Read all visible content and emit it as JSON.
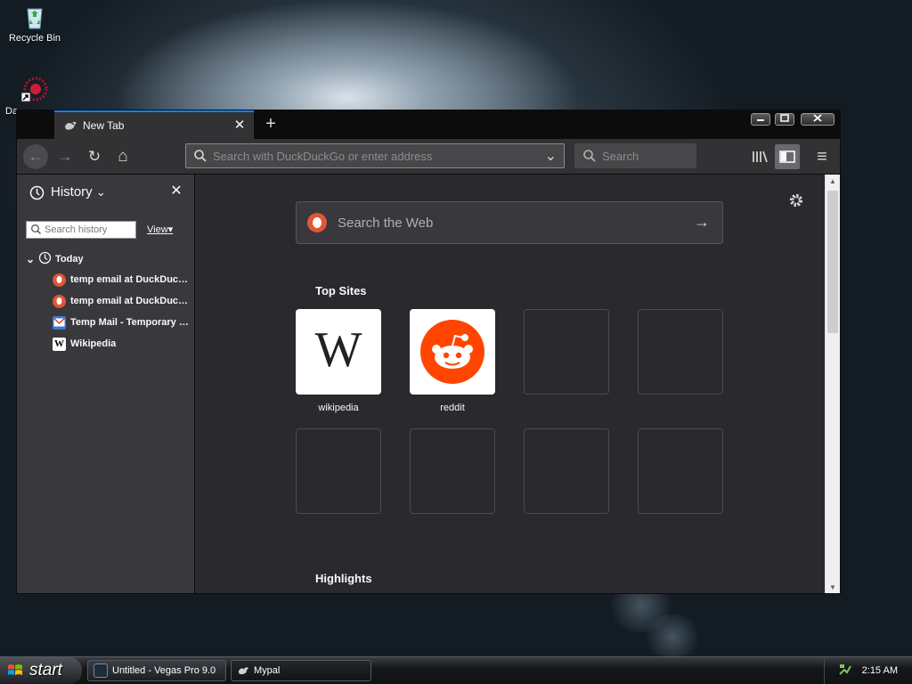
{
  "desktop": {
    "icons": [
      {
        "label": "Recycle Bin"
      },
      {
        "label": "Da"
      }
    ]
  },
  "browser": {
    "tab": {
      "title": "New Tab",
      "close": "✕"
    },
    "new_tab": "+",
    "window_controls": {
      "minimize": "▬",
      "maximize": "▢",
      "close": "✕"
    },
    "nav": {
      "back": "←",
      "forward": "→",
      "reload": "↻",
      "home": "⌂",
      "url_placeholder": "Search with DuckDuckGo or enter address",
      "url_dropdown": "⌄",
      "search_placeholder": "Search",
      "library": "|||\\",
      "sidebar_toggle": "▣",
      "menu": "≡"
    }
  },
  "sidebar": {
    "title": "History",
    "title_caret": "⌄",
    "close": "✕",
    "search_placeholder": "Search history",
    "view_label": "View",
    "view_caret": "▾",
    "group_toggle": "⌄",
    "group_label": "Today",
    "history_items": [
      {
        "label": "temp email at DuckDuck...",
        "icon": "duckduckgo-icon"
      },
      {
        "label": "temp email at DuckDuck...",
        "icon": "duckduckgo-icon"
      },
      {
        "label": "Temp Mail - Temporary E...",
        "icon": "mail-icon"
      },
      {
        "label": "Wikipedia",
        "icon": "wikipedia-icon"
      }
    ]
  },
  "newtab": {
    "settings_icon": "gear-icon",
    "search_text": "Search the Web",
    "search_arrow": "→",
    "top_sites_title": "Top Sites",
    "top_sites": [
      {
        "label": "wikipedia",
        "logo": "W"
      },
      {
        "label": "reddit",
        "logo": "reddit"
      },
      {
        "label": ""
      },
      {
        "label": ""
      },
      {
        "label": ""
      },
      {
        "label": ""
      },
      {
        "label": ""
      },
      {
        "label": ""
      }
    ],
    "highlights_title": "Highlights"
  },
  "taskbar": {
    "start_label": "start",
    "tasks": [
      {
        "label": "Untitled - Vegas Pro 9.0"
      },
      {
        "label": "Mypal"
      }
    ],
    "clock": "2:15 AM"
  },
  "colors": {
    "accent": "#0a84ff",
    "reddit": "#ff4500",
    "duckduckgo": "#de5833"
  }
}
